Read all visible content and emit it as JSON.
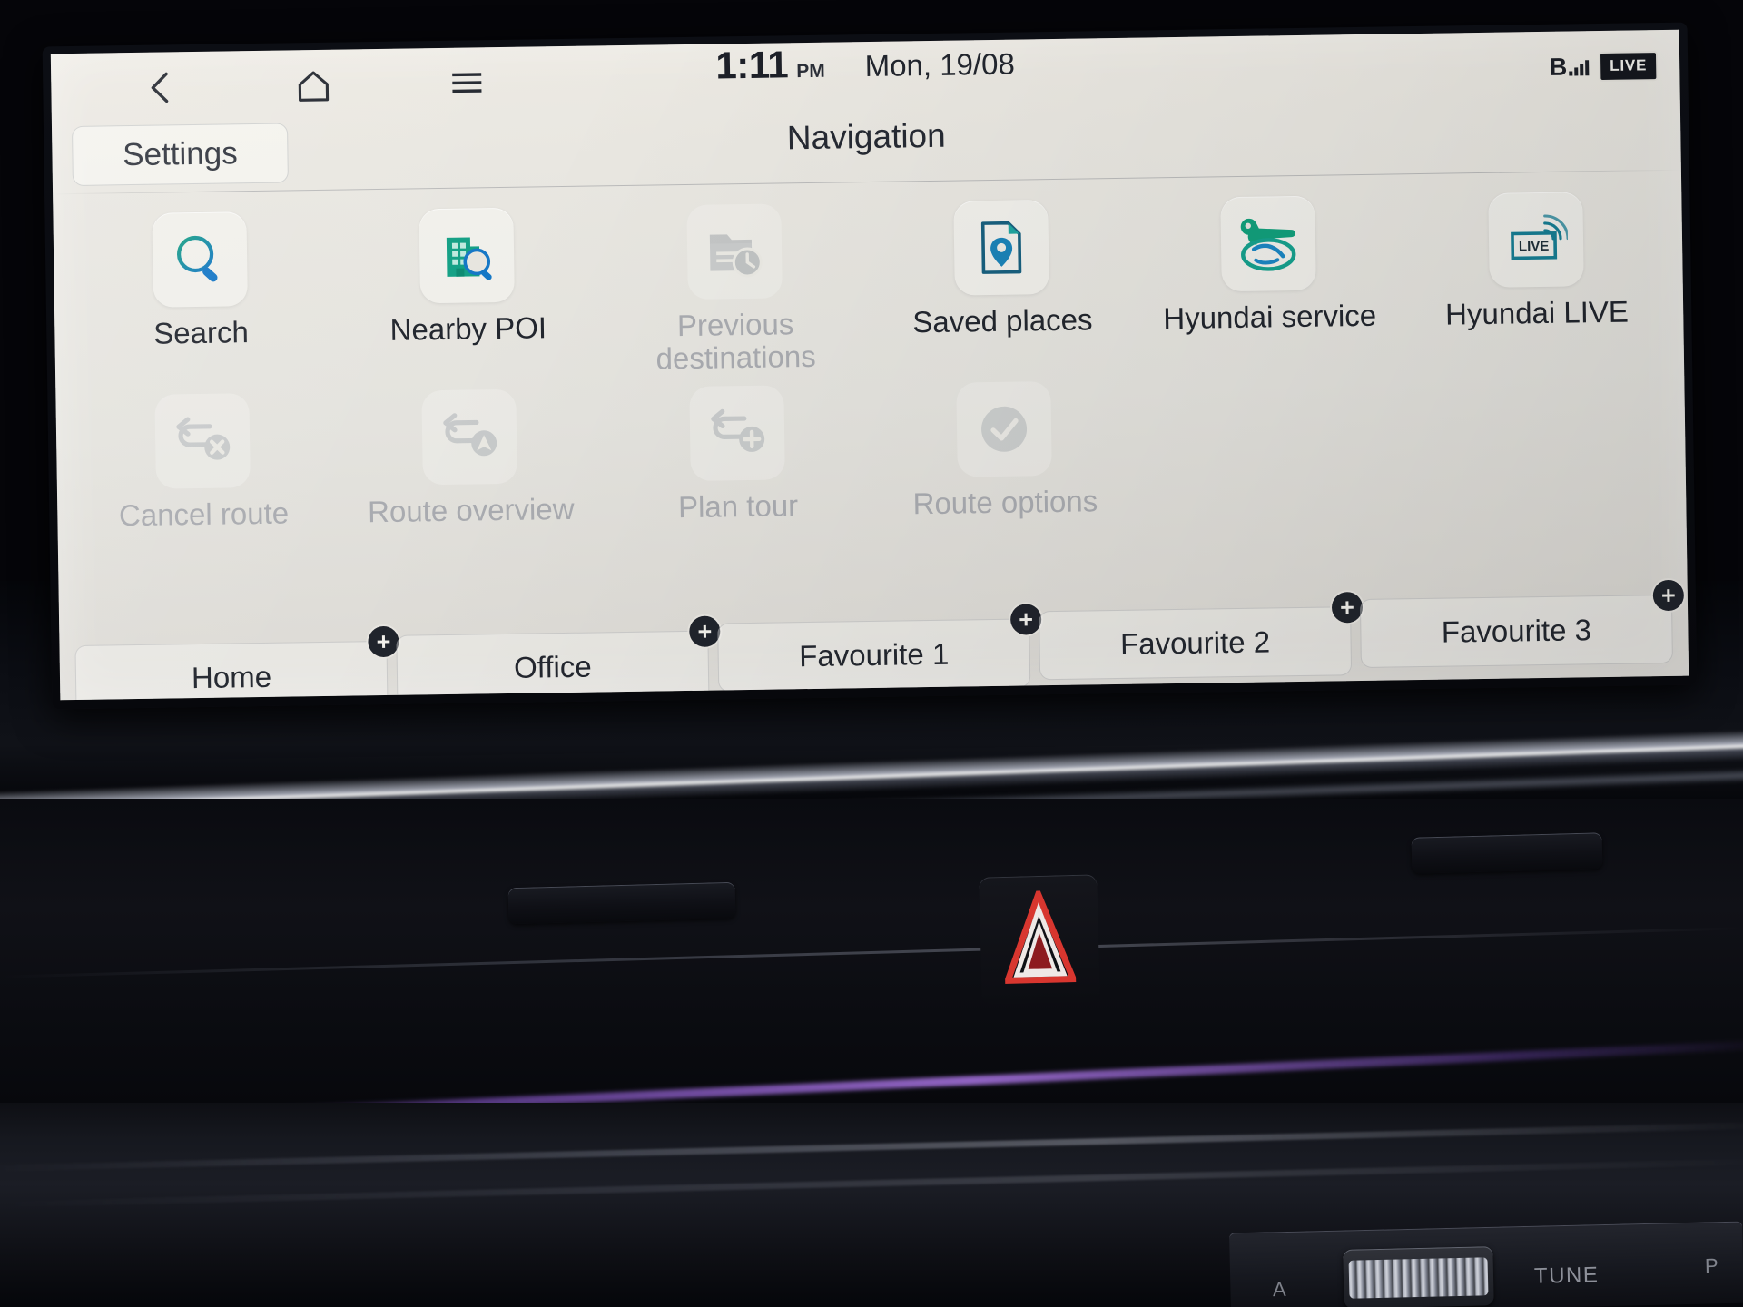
{
  "status_bar": {
    "back_icon": "chevron-left-icon",
    "home_icon": "home-icon",
    "menu_icon": "hamburger-menu-icon",
    "time": "1:11",
    "am_pm": "PM",
    "date": "Mon, 19/08",
    "bluetooth_label": "B",
    "live_badge": "LIVE"
  },
  "header": {
    "settings_label": "Settings",
    "title": "Navigation"
  },
  "menu": {
    "row1": [
      {
        "label": "Search",
        "icon": "search-magnifier-icon",
        "enabled": true
      },
      {
        "label": "Nearby POI",
        "icon": "building-search-icon",
        "enabled": true
      },
      {
        "label": "Previous destinations",
        "icon": "folder-clock-icon",
        "enabled": false
      },
      {
        "label": "Saved places",
        "icon": "document-pin-icon",
        "enabled": true
      },
      {
        "label": "Hyundai service",
        "icon": "wrench-hyundai-logo-icon",
        "enabled": true
      },
      {
        "label": "Hyundai LIVE",
        "icon": "live-broadcast-icon",
        "enabled": true
      }
    ],
    "row2": [
      {
        "label": "Cancel route",
        "icon": "route-cancel-icon",
        "enabled": false
      },
      {
        "label": "Route overview",
        "icon": "route-overview-icon",
        "enabled": false
      },
      {
        "label": "Plan tour",
        "icon": "route-add-icon",
        "enabled": false
      },
      {
        "label": "Route options",
        "icon": "check-circle-icon",
        "enabled": false
      }
    ]
  },
  "favourites": [
    {
      "label": "Home",
      "add_badge": "+"
    },
    {
      "label": "Office",
      "add_badge": "+"
    },
    {
      "label": "Favourite 1",
      "add_badge": "+"
    },
    {
      "label": "Favourite 2",
      "add_badge": "+"
    },
    {
      "label": "Favourite 3",
      "add_badge": "+"
    }
  ],
  "dashboard": {
    "hazard_button": "hazard-warning-triangle",
    "tune_label": "TUNE",
    "secondary_label": "P",
    "tertiary_label": "A"
  },
  "colors": {
    "accent_teal": "#16a085",
    "accent_blue": "#1b7fc4",
    "screen_bg": "#e7e5df",
    "text": "#22262e",
    "disabled_text": "#a9abb0",
    "hazard_red": "#b8232a"
  }
}
